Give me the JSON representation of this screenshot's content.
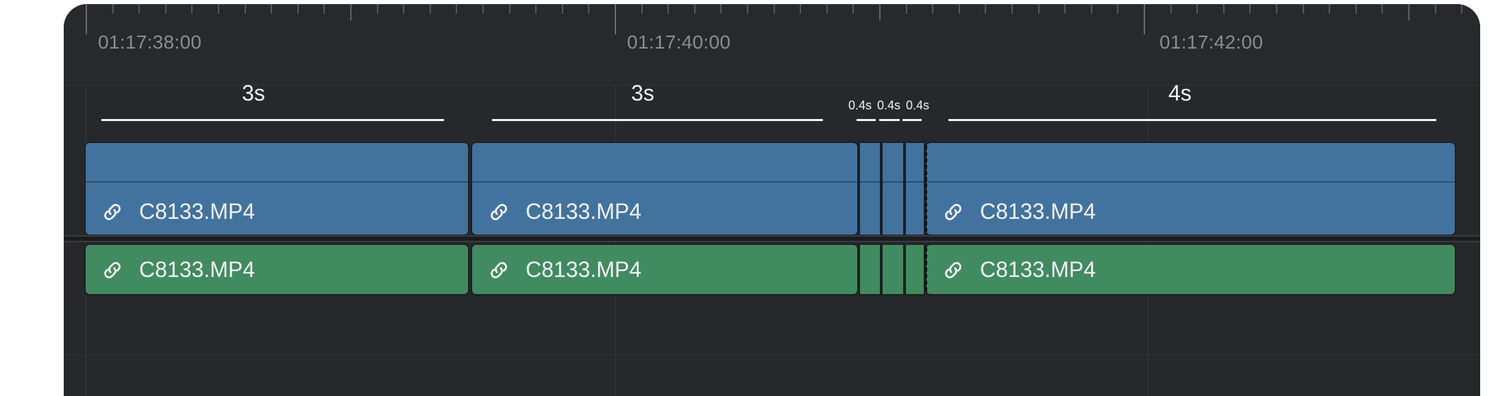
{
  "timeline": {
    "ruler": {
      "timecodes": [
        "01:17:38:00",
        "01:17:40:00",
        "01:17:42:00"
      ]
    },
    "durations": [
      "3s",
      "3s",
      "0.4s",
      "0.4s",
      "0.4s",
      "4s"
    ],
    "video_track": {
      "clips": [
        {
          "name": "C8133.MP4",
          "linked": true
        },
        {
          "name": "C8133.MP4",
          "linked": true
        },
        {
          "name": "",
          "linked": false
        },
        {
          "name": "",
          "linked": false
        },
        {
          "name": "",
          "linked": false
        },
        {
          "name": "C8133.MP4",
          "linked": true
        }
      ]
    },
    "audio_track": {
      "clips": [
        {
          "name": "C8133.MP4",
          "linked": true
        },
        {
          "name": "C8133.MP4",
          "linked": true
        },
        {
          "name": "",
          "linked": false
        },
        {
          "name": "",
          "linked": false
        },
        {
          "name": "",
          "linked": false
        },
        {
          "name": "C8133.MP4",
          "linked": true
        }
      ]
    },
    "colors": {
      "background": "#27282b",
      "video_clip": "#42739e",
      "audio_clip": "#408b60",
      "text": "#f3f4f5",
      "timecode": "#8a8c91"
    },
    "icons": {
      "link": "link-icon"
    }
  }
}
